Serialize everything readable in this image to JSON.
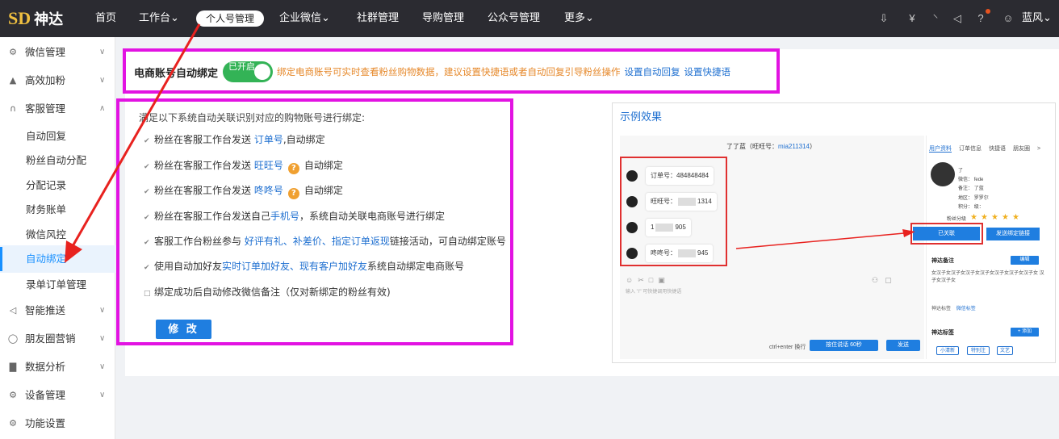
{
  "app": {
    "logo_mark": "SD",
    "logo_text": "神达"
  },
  "topnav": {
    "items": [
      "首页",
      "工作台⌄",
      "个人号管理",
      "企业微信⌄",
      "社群管理",
      "导购管理",
      "公众号管理",
      "更多⌄"
    ],
    "active_index": 2,
    "user_name": "蓝风⌄",
    "icons": [
      "download-icon",
      "yen-icon",
      "headset-icon",
      "speaker-icon",
      "help-icon",
      "user-circle-icon"
    ]
  },
  "sidebar": {
    "items": [
      {
        "label": "微信管理",
        "icon": "gears-icon",
        "expandable": true
      },
      {
        "label": "高效加粉",
        "icon": "person-icon",
        "expandable": true
      },
      {
        "label": "客服管理",
        "icon": "headset-icon",
        "expandable": true
      },
      {
        "label": "自动回复",
        "sub": true
      },
      {
        "label": "粉丝自动分配",
        "sub": true
      },
      {
        "label": "分配记录",
        "sub": true
      },
      {
        "label": "财务账单",
        "sub": true
      },
      {
        "label": "微信风控",
        "sub": true
      },
      {
        "label": "自动绑定",
        "sub": true,
        "active": true
      },
      {
        "label": "录单订单管理",
        "sub": true
      },
      {
        "label": "智能推送",
        "icon": "send-icon",
        "expandable": true
      },
      {
        "label": "朋友圈营销",
        "icon": "chat-bubble-icon",
        "expandable": true
      },
      {
        "label": "数据分析",
        "icon": "bar-chart-icon",
        "expandable": true
      },
      {
        "label": "设备管理",
        "icon": "gears-icon",
        "expandable": true
      },
      {
        "label": "功能设置",
        "icon": "gears-icon",
        "expandable": false
      }
    ]
  },
  "binding": {
    "title": "电商账号自动绑定",
    "toggle_label": "已开启",
    "toggle_on": true,
    "note": "绑定电商账号可实时查看粉丝购物数据，建议设置快捷语或者自动回复引导粉丝操作",
    "link_auto_reply": "设置自动回复",
    "link_shortcut": "设置快捷语"
  },
  "rules": {
    "intro": "满足以下系统自动关联识别对应的购物账号进行绑定:",
    "r1": {
      "a": "粉丝在客服工作台发送 ",
      "b": "订单号",
      "c": ",自动绑定"
    },
    "r2": {
      "a": "粉丝在客服工作台发送 ",
      "b": "旺旺号",
      "c": "自动绑定"
    },
    "r3": {
      "a": "粉丝在客服工作台发送 ",
      "b": "咚咚号",
      "c": "自动绑定"
    },
    "r4": {
      "a": "粉丝在客服工作台发送自己",
      "b": "手机号",
      "c": "，系统自动关联电商账号进行绑定"
    },
    "r5": {
      "a": "客服工作台粉丝参与 ",
      "b": "好评有礼、补差价、指定订单返现",
      "c": "链接活动，可自动绑定账号"
    },
    "r6": {
      "a": "使用自动加好友",
      "b": "实时订单加好友、现有客户加好友",
      "c": "系统自动绑定电商账号"
    },
    "r7": {
      "a": "绑定成功后自动修改微信备注（仅对新绑定的粉丝有效)"
    },
    "modify_button": "修 改"
  },
  "demo": {
    "title": "示例效果",
    "chat_title": "了了蓝（旺旺号：",
    "chat_id": "mia211314",
    "chat_title_end": "）",
    "bubbles": [
      "订单号：",
      "484848484",
      "旺旺号：",
      "1314",
      "1",
      "905",
      "咚咚号：",
      "945"
    ],
    "input_hint": "输入 \"/\" 可快捷调用快捷语",
    "ctrl_hint": "ctrl+enter 换行",
    "btn_send_timer": "按住说话     60秒",
    "btn_send": "发送",
    "tabs": [
      "用户资料",
      "订单信息",
      "快捷语",
      "朋友圈",
      ">"
    ],
    "profile_lines": [
      "了",
      "微信：",
      "备注：",
      "地区：",
      "积分："
    ],
    "profile_extra": [
      "fede",
      "了蓝",
      "罗罗尔",
      "级："
    ],
    "stars_label": "粉丝分级",
    "stars": 5,
    "btn_bound": "已关联",
    "btn_send_bind": "发送绑定链接",
    "remark_title": "神达备注",
    "remark_btn": "编辑",
    "remark_text": "女汉子女汉子女汉子女汉子女汉子女汉子女汉子女 汉子女汉子女",
    "tag_tabs": [
      "神达标签",
      "微信标签"
    ],
    "tag_title": "神达标签",
    "tag_btn": "+ 添加",
    "tags": [
      "小清新",
      "特别注",
      "文艺"
    ]
  }
}
